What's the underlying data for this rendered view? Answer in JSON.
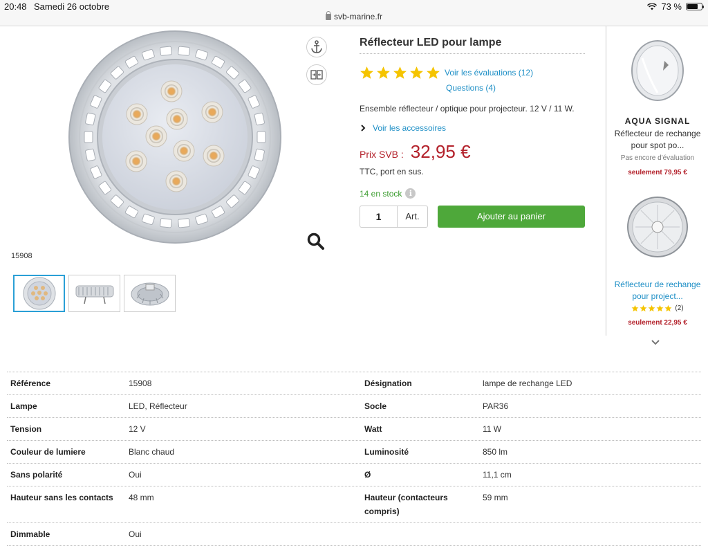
{
  "status": {
    "time": "20:48",
    "date": "Samedi 26 octobre",
    "battery": "73 %",
    "battery_level": 0.73
  },
  "browser": {
    "url": "svb-marine.fr"
  },
  "gallery": {
    "ref_code": "15908",
    "thumbnail_count": 3,
    "active_thumbnail": 0
  },
  "product": {
    "title": "Réflecteur LED pour lampe",
    "rating": 5,
    "reviews_link": "Voir les évaluations (12)",
    "questions_link": "Questions (4)",
    "description": "Ensemble réflecteur / optique pour projecteur. 12 V / 11 W.",
    "accessories_link": "Voir les accessoires",
    "price_label": "Prix SVB :",
    "price": "32,95 €",
    "tax_note": "TTC, port en sus.",
    "stock": "14 en stock",
    "quantity": "1",
    "unit": "Art.",
    "add_to_cart": "Ajouter au panier"
  },
  "recommendations": [
    {
      "brand": "AQUA SIGNAL",
      "name_line1": "Réflecteur de rechange",
      "name_line2": "pour spot po...",
      "note": "Pas encore d'évaluation",
      "price": "seulement 79,95 €"
    },
    {
      "brand": "",
      "name_line1": "Réflecteur de rechange",
      "name_line2": "pour project...",
      "rating": 5,
      "review_count": "(2)",
      "price": "seulement 22,95 €"
    }
  ],
  "specs": [
    {
      "label1": "Référence",
      "value1": "15908",
      "label2": "Désignation",
      "value2": "lampe de rechange LED"
    },
    {
      "label1": "Lampe",
      "value1": "LED, Réflecteur",
      "label2": "Socle",
      "value2": "PAR36"
    },
    {
      "label1": "Tension",
      "value1": "12 V",
      "label2": "Watt",
      "value2": "11 W"
    },
    {
      "label1": "Couleur de lumiere",
      "value1": "Blanc chaud",
      "label2": "Luminosité",
      "value2": "850 lm"
    },
    {
      "label1": "Sans polarité",
      "value1": "Oui",
      "label2": "Ø",
      "value2": "11,1 cm"
    },
    {
      "label1": "Hauteur sans les contacts",
      "value1": "48 mm",
      "label2": "Hauteur (contacteurs compris)",
      "value2": "59 mm"
    },
    {
      "label1": "Dimmable",
      "value1": "Oui",
      "label2": "",
      "value2": ""
    }
  ],
  "colors": {
    "accent_link": "#1e8fc6",
    "price_red": "#b3202a",
    "cart_green": "#4ea83a",
    "stock_green": "#3b9c2f",
    "star_yellow": "#f5c400"
  }
}
